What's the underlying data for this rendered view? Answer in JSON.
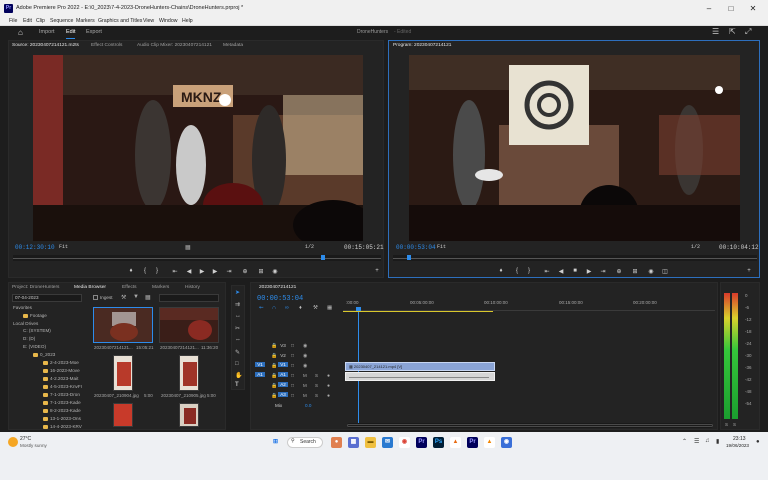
{
  "title": "Adobe Premiere Pro 2022 - E:\\0_2023\\7-4-2023-DroneHunters-Chains\\DroneHunters.prproj *",
  "app_logo": "Pr",
  "menu": [
    "File",
    "Edit",
    "Clip",
    "Sequence",
    "Markers",
    "Graphics and Titles",
    "View",
    "Window",
    "Help"
  ],
  "workspaces": [
    "Import",
    "Edit",
    "Export"
  ],
  "project_name": "DroneHunters",
  "project_state": "- Edited",
  "source": {
    "tabs": [
      "Source: 20230407214121.m2ts",
      "Effect Controls",
      "Audio Clip Mixer: 20230407214121",
      "Metadata"
    ],
    "tc_left": "00:12:30:10",
    "fit": "Fit",
    "tc_right": "00:15:05:21",
    "res": "1/2"
  },
  "program": {
    "tab": "Program: 20230407214121",
    "tc_left": "00:00:53:04",
    "fit": "Fit",
    "tc_right": "00:10:04:12",
    "res": "1/2"
  },
  "project_panel": {
    "tabs": [
      "Project: DroneHunters",
      "Media Browser",
      "Effects",
      "Markers",
      "History"
    ],
    "date_field": "07-04-2023",
    "ingest": "Ingest",
    "tree": [
      "Favorites",
      "Footage",
      "Local Drives",
      "C: (SYSTEM)",
      "D: (D)",
      "E: (VIDEO)",
      "0_2023",
      "2-4-2023-Moe",
      "16-2023-Move",
      "4-2.2023-Mait",
      "4-5-2023-KnvFI",
      "7-1-2023-Dron",
      "7-1-2023-Kade",
      "8-2-2023-Kade",
      "13-1-2023-Ons",
      "14-4-2023-KRV",
      "18-4-2023-Mac"
    ],
    "thumbs": [
      {
        "name": "20230407214121...",
        "dur": "15:05:21"
      },
      {
        "name": "20230407214121...",
        "dur": "11:36:20"
      },
      {
        "name": "20230407_210904.jpg",
        "dur": "5:00"
      },
      {
        "name": "20230407_210905.jpg",
        "dur": "5:00"
      }
    ]
  },
  "timeline": {
    "seq": "20230407214121",
    "tc": "00:00:53:04",
    "ruler": [
      ":00:00",
      "00:05:00:00",
      "00:10:00:00",
      "00:15:00:00",
      "00:20:00:00"
    ],
    "tracks": [
      {
        "v": "V3"
      },
      {
        "v": "V2"
      },
      {
        "v": "V1",
        "src": "V1"
      },
      {
        "v": "A1",
        "src": "A1"
      },
      {
        "v": "A2"
      },
      {
        "v": "A3"
      }
    ],
    "mix": "Mix",
    "mix_val": "0.0",
    "clip_label": "20230407_214121.mp4 [V]"
  },
  "meter": {
    "labels": [
      "0",
      "-6",
      "-12",
      "-18",
      "-24",
      "-30",
      "-36",
      "-42",
      "-48",
      "-54"
    ],
    "sm": [
      "S",
      "S"
    ]
  },
  "taskbar": {
    "temp": "27°C",
    "weather": "Mostly sunny",
    "search": "Search",
    "time": "23:13",
    "date": "19/06/2023"
  }
}
